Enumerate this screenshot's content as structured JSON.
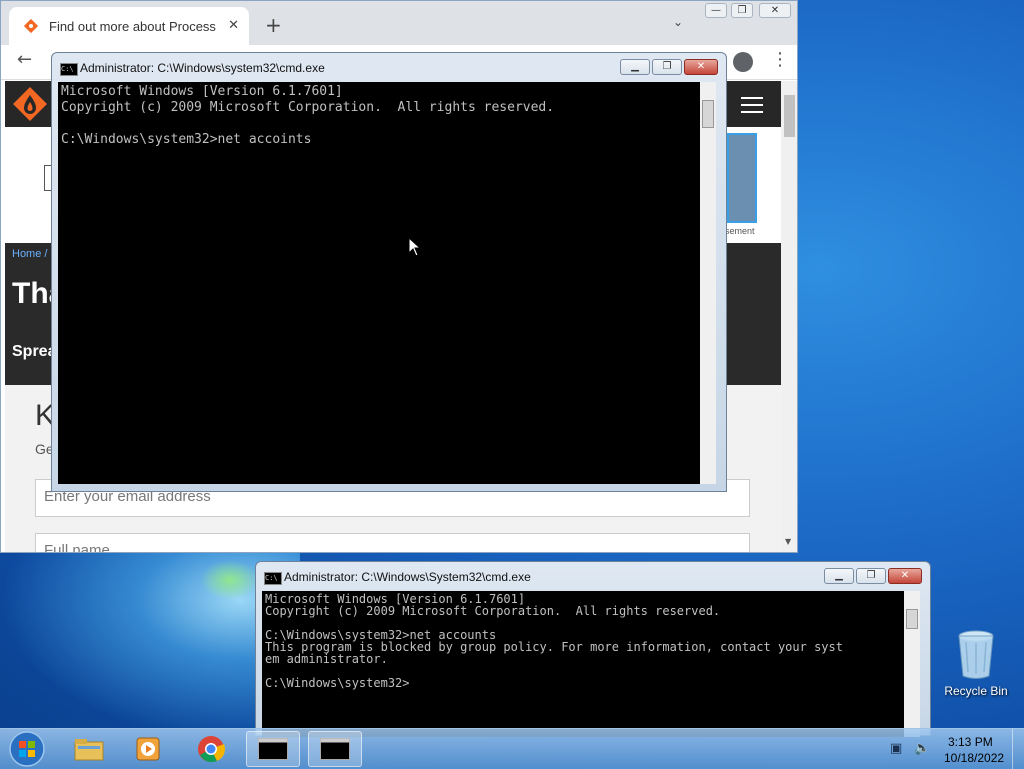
{
  "browser": {
    "tab_title": "Find out more about Process Ha",
    "tab_close": "✕",
    "new_tab": "+",
    "chevron": "⌄",
    "win_min": "—",
    "win_max": "❐",
    "win_close": "✕",
    "back": "←",
    "kebab": "⋮",
    "ad_label": "sement",
    "breadcrumb": "Home /",
    "hero_title": "Tha",
    "hero_sub": "Sprea",
    "form_heading": "K",
    "form_sub": "Ge",
    "email_placeholder": "Enter your email address",
    "name_placeholder": "Full name"
  },
  "cmd_main": {
    "title": "Administrator: C:\\Windows\\system32\\cmd.exe",
    "lines": "Microsoft Windows [Version 6.1.7601]\nCopyright (c) 2009 Microsoft Corporation.  All rights reserved.\n\nC:\\Windows\\system32>net accoints",
    "min": "▁",
    "max": "❐",
    "close": "✕"
  },
  "cmd_second": {
    "title": "Administrator: C:\\Windows\\System32\\cmd.exe",
    "lines": "Microsoft Windows [Version 6.1.7601]\nCopyright (c) 2009 Microsoft Corporation.  All rights reserved.\n\nC:\\Windows\\system32>net accounts\nThis program is blocked by group policy. For more information, contact your syst\nem administrator.\n\nC:\\Windows\\system32>",
    "min": "▁",
    "max": "❐",
    "close": "✕"
  },
  "desktop": {
    "recycle_bin_label": "Recycle Bin"
  },
  "taskbar": {
    "time": "3:13 PM",
    "date": "10/18/2022",
    "cmd_icon_text": "C:\\_"
  }
}
